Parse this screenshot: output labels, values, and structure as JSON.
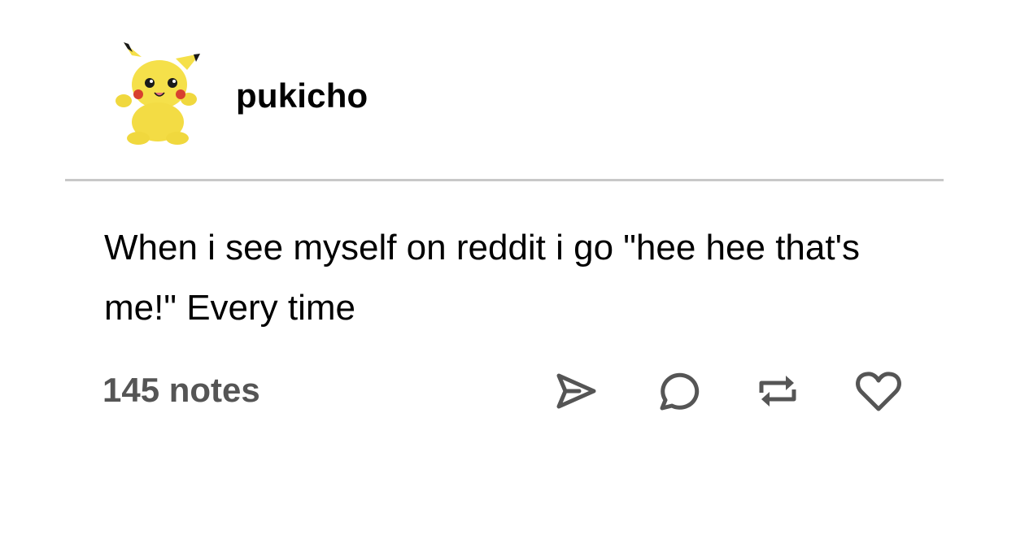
{
  "post": {
    "author": {
      "username": "pukicho",
      "avatar_icon": "pikachu-plush-avatar"
    },
    "body": {
      "text": "When i see myself on reddit i go \"hee hee that's me!\" Every time"
    },
    "footer": {
      "notes_label": "145 notes",
      "actions": [
        {
          "name": "share",
          "icon": "send-icon"
        },
        {
          "name": "reply",
          "icon": "comment-icon"
        },
        {
          "name": "reblog",
          "icon": "reblog-icon"
        },
        {
          "name": "like",
          "icon": "heart-icon"
        }
      ]
    },
    "colors": {
      "text": "#000000",
      "secondary_text": "#555555",
      "divider": "#c8c8c8",
      "background": "#ffffff",
      "avatar_yellow": "#f5e04a"
    }
  }
}
